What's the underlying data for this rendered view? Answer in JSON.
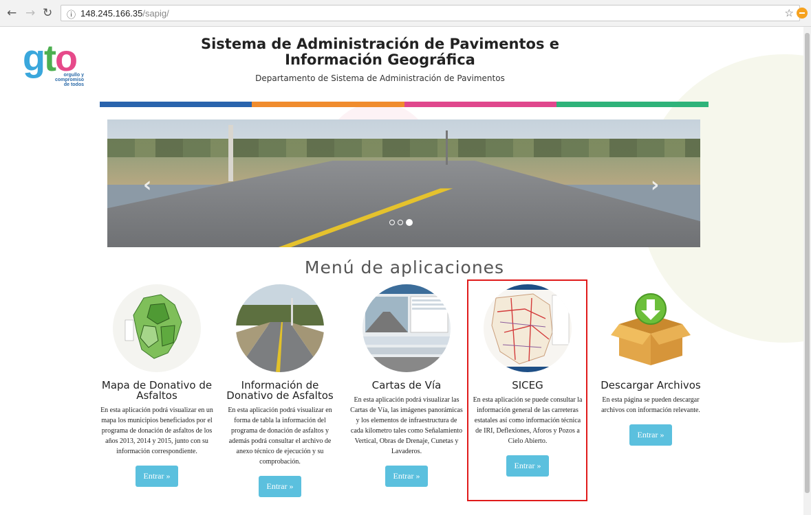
{
  "browser": {
    "url_host": "148.245.166.35",
    "url_path": "/sapig/",
    "info_glyph": "ⓘ"
  },
  "logo": {
    "g": "g",
    "t": "t",
    "o": "o",
    "line1": "orgullo y",
    "line2": "compromiso",
    "line3": "de todos"
  },
  "header": {
    "title": "Sistema de Administración de Pavimentos e Información Geográfica",
    "subtitle": "Departamento de Sistema de Administración de Pavimentos"
  },
  "colorbar": [
    "#2a64ad",
    "#f08c2e",
    "#e0478d",
    "#2fb37a"
  ],
  "carousel": {
    "prev": "‹",
    "next": "›",
    "slides": 3,
    "active_slide": 3
  },
  "menu": {
    "title": "Menú de aplicaciones",
    "apps": [
      {
        "title": "Mapa de Donativo de Asfaltos",
        "desc": "En esta aplicación podrá visualizar en un mapa los municipios beneficiados por el programa de donación de asfaltos de los años 2013, 2014 y 2015, junto con su información correspondiente.",
        "button": "Entrar »"
      },
      {
        "title": "Información de Donativo de Asfaltos",
        "desc": "En esta aplicación podrá visualizar en forma de tabla la información del programa de donación de asfaltos y además podrá consultar el archivo de anexo técnico de ejecución y su comprobación.",
        "button": "Entrar »"
      },
      {
        "title": "Cartas de Vía",
        "desc": "En esta aplicación podrá visualizar las Cartas de Vía, las imágenes panorámicas y los elementos de infraestructura de cada kilometro tales como Señalamiento Vertical, Obras de Drenaje, Cunetas y Lavaderos.",
        "button": "Entrar »"
      },
      {
        "title": "SICEG",
        "desc": "En esta aplicación se puede consultar la información general de las carreteras estatales así como información técnica de IRI, Deflexiones, Aforos y Pozos a Cielo Abierto.",
        "button": "Entrar »"
      },
      {
        "title": "Descargar Archivos",
        "desc": "En esta página se pueden descargar archivos con información relevante.",
        "button": "Entrar »"
      }
    ]
  }
}
